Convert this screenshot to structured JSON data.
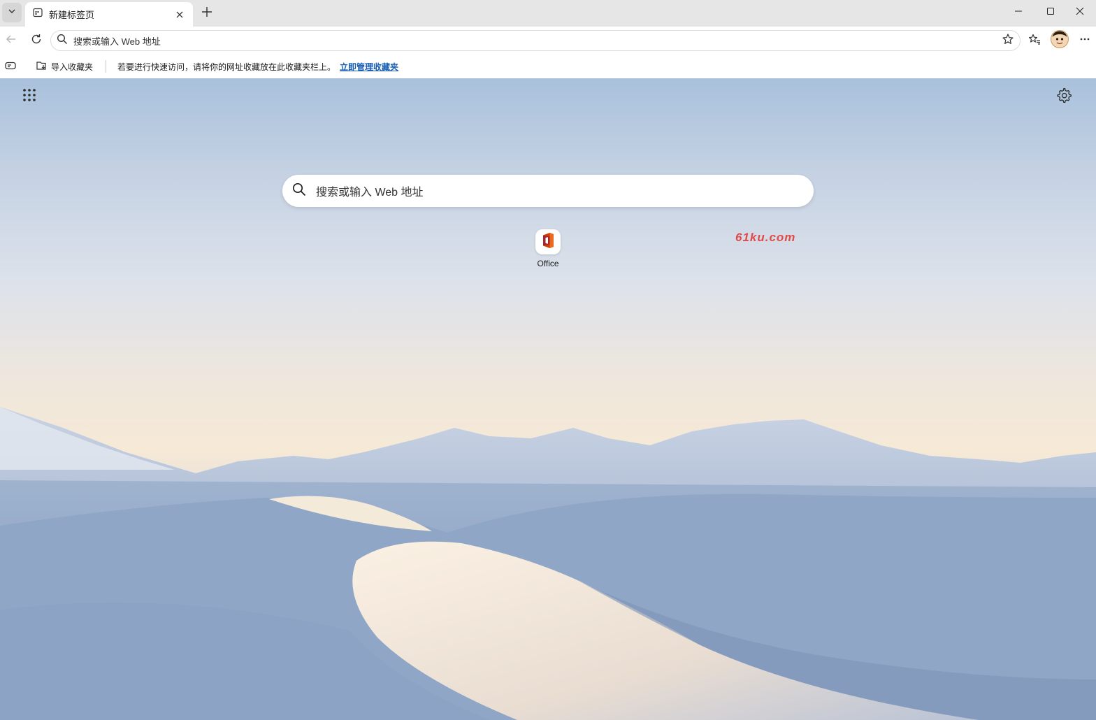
{
  "tab": {
    "title": "新建标签页"
  },
  "toolbar": {
    "omnibox_text": "搜索或输入 Web 地址"
  },
  "favorites_bar": {
    "import_label": "导入收藏夹",
    "hint_text": "若要进行快速访问，请将你的网址收藏放在此收藏夹栏上。",
    "manage_link": "立即管理收藏夹"
  },
  "main": {
    "search_placeholder": "搜索或输入 Web 地址",
    "quick_links": [
      {
        "label": "Office"
      }
    ],
    "watermark": "61ku.com"
  },
  "colors": {
    "link": "#1a5fb4",
    "office_red": "#d83b01",
    "office_orange": "#ea6a1e",
    "watermark": "#e24a4a"
  },
  "icons": [
    "tab-list-icon",
    "newtab-page-icon",
    "close-icon",
    "plus-icon",
    "minimize-icon",
    "maximize-icon",
    "window-close-icon",
    "back-icon",
    "refresh-icon",
    "search-icon",
    "star-icon",
    "favorites-icon",
    "avatar",
    "more-icon",
    "sidebar-toggle-icon",
    "import-favorites-icon",
    "apps-grid-icon",
    "gear-icon",
    "office-icon"
  ]
}
